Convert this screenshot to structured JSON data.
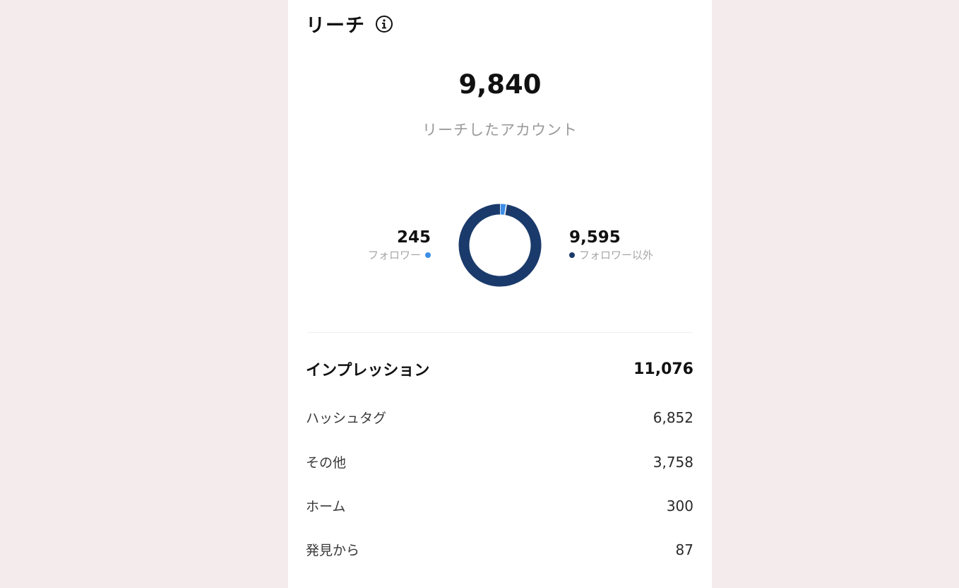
{
  "reach": {
    "title": "リーチ",
    "info_icon": "info-icon",
    "total": "9,840",
    "total_label": "リーチしたアカウント",
    "followers": {
      "value": "245",
      "label": "フォロワー",
      "color": "#3d8ee6"
    },
    "non_followers": {
      "value": "9,595",
      "label": "フォロワー以外",
      "color": "#1a3a6b"
    }
  },
  "chart_data": {
    "type": "pie",
    "categories": [
      "フォロワー",
      "フォロワー以外"
    ],
    "values": [
      245,
      9595
    ],
    "colors": [
      "#3d8ee6",
      "#1a3a6b"
    ]
  },
  "impressions": {
    "label": "インプレッション",
    "value": "11,076",
    "sources": [
      {
        "label": "ハッシュタグ",
        "value": "6,852"
      },
      {
        "label": "その他",
        "value": "3,758"
      },
      {
        "label": "ホーム",
        "value": "300"
      },
      {
        "label": "発見から",
        "value": "87"
      }
    ]
  }
}
